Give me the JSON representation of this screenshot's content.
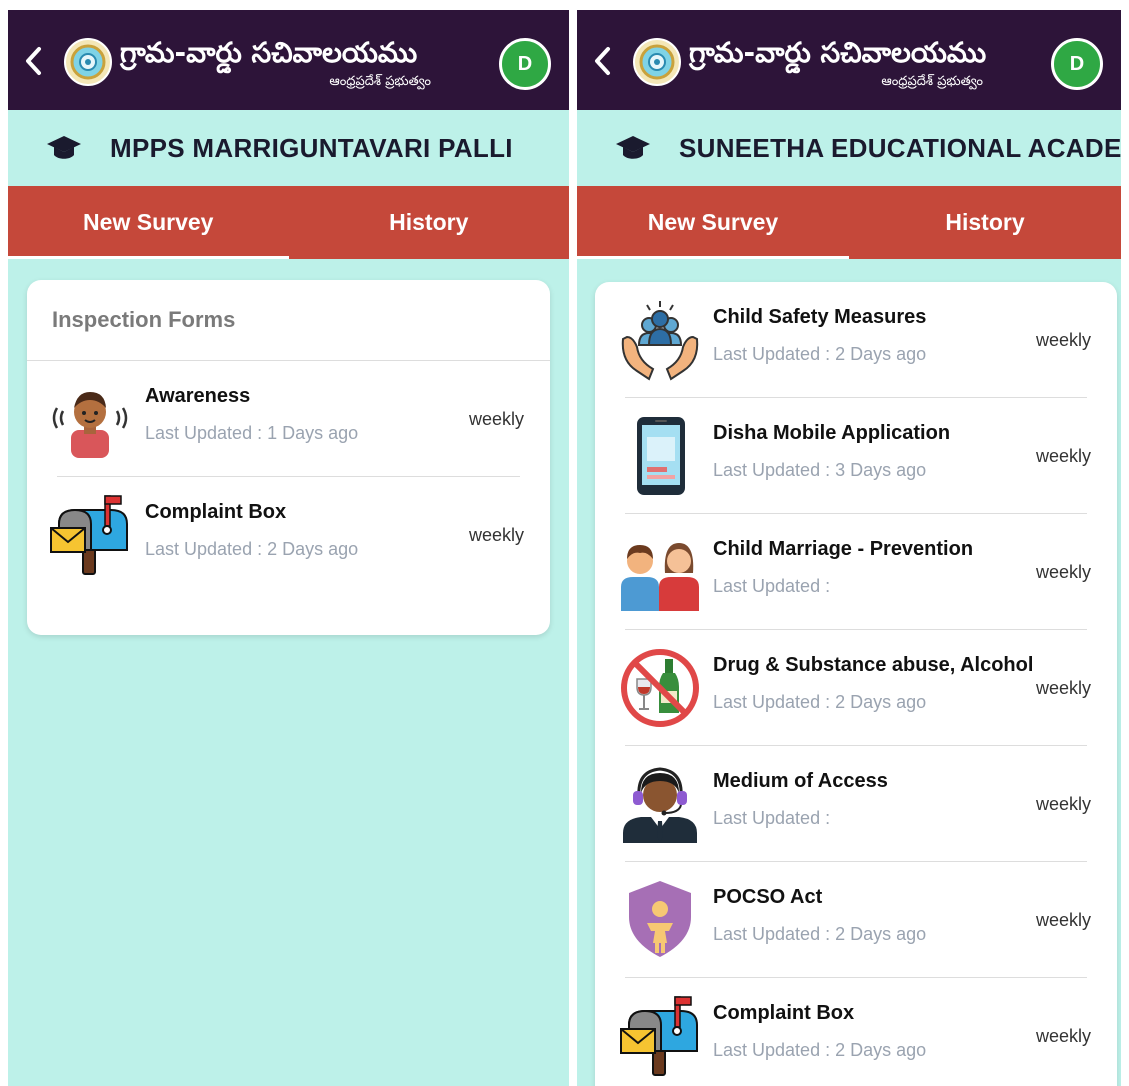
{
  "app": {
    "title": "గ్రామ-వార్డు సచివాలయము",
    "subtitle": "ఆంధ్రప్రదేశ్ ప్రభుత్వం",
    "avatar_letter": "D"
  },
  "colors": {
    "appbar_bg": "#2d1439",
    "tabbar_bg": "#c5483a",
    "content_bg": "#bdf1e9",
    "avatar_bg": "#2fa844"
  },
  "left": {
    "school_name": "MPPS MARRIGUNTAVARI PALLI",
    "tabs": [
      "New Survey",
      "History"
    ],
    "card_heading": "Inspection Forms",
    "forms": [
      {
        "title": "Awareness",
        "updated": "Last Updated : 1 Days ago",
        "frequency": "weekly",
        "icon": "awareness-icon"
      },
      {
        "title": "Complaint Box",
        "updated": "Last Updated : 2 Days ago",
        "frequency": "weekly",
        "icon": "mailbox-icon"
      }
    ]
  },
  "right": {
    "school_name": "SUNEETHA EDUCATIONAL ACADEMY",
    "tabs": [
      "New Survey",
      "History"
    ],
    "forms": [
      {
        "title": "Child Safety Measures",
        "updated": "Last Updated : 2 Days ago",
        "frequency": "weekly",
        "icon": "child-safety-icon"
      },
      {
        "title": "Disha Mobile Application",
        "updated": "Last Updated : 3 Days ago",
        "frequency": "weekly",
        "icon": "mobile-phone-icon"
      },
      {
        "title": "Child Marriage - Prevention",
        "updated": "Last Updated :",
        "frequency": "weekly",
        "icon": "couple-icon"
      },
      {
        "title": "Drug & Substance abuse, Alcohol",
        "updated": "Last Updated : 2 Days ago",
        "frequency": "weekly",
        "icon": "no-alcohol-icon"
      },
      {
        "title": "Medium of Access",
        "updated": "Last Updated :",
        "frequency": "weekly",
        "icon": "headset-agent-icon"
      },
      {
        "title": "POCSO Act",
        "updated": "Last Updated : 2 Days ago",
        "frequency": "weekly",
        "icon": "shield-child-icon"
      },
      {
        "title": "Complaint Box",
        "updated": "Last Updated : 2 Days ago",
        "frequency": "weekly",
        "icon": "mailbox-icon"
      }
    ]
  }
}
